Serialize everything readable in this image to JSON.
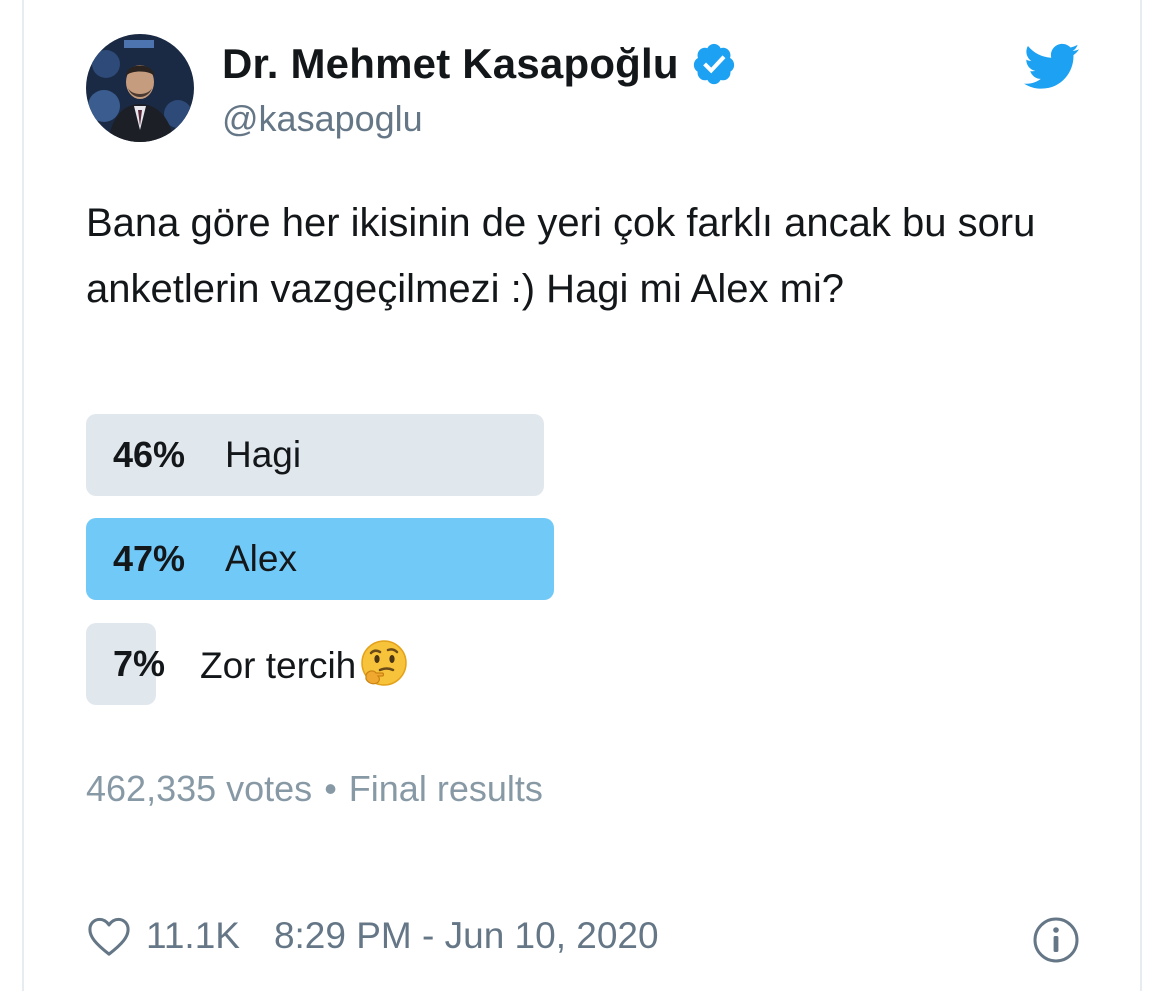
{
  "author": {
    "display_name": "Dr. Mehmet Kasapoğlu",
    "handle": "@kasapoglu",
    "verified": true
  },
  "tweet": {
    "text": "Bana göre her ikisinin de yeri çok farklı ancak bu soru anketlerin vazgeçilmezi :) Hagi mi Alex mi?"
  },
  "poll": {
    "options": [
      {
        "percent_label": "46%",
        "label": "Hagi",
        "percent": 46,
        "winner": false
      },
      {
        "percent_label": "47%",
        "label": "Alex",
        "percent": 47,
        "winner": true
      },
      {
        "percent_label": "7%",
        "label": "Zor tercih",
        "emoji": "thinking-face",
        "percent": 7,
        "winner": false
      }
    ],
    "votes": "462,335 votes",
    "separator": "•",
    "status": "Final results"
  },
  "footer": {
    "likes": "11.1K",
    "timestamp": "8:29 PM - Jun 10, 2020"
  },
  "icons": {
    "brand": "twitter-bird-icon",
    "verified": "verified-badge-icon",
    "like": "heart-icon",
    "info": "info-icon"
  },
  "colors": {
    "brand_blue": "#1da1f2",
    "winner_bar": "#71c9f8",
    "bar": "#e1e8ed",
    "muted_text": "#8899a6"
  }
}
